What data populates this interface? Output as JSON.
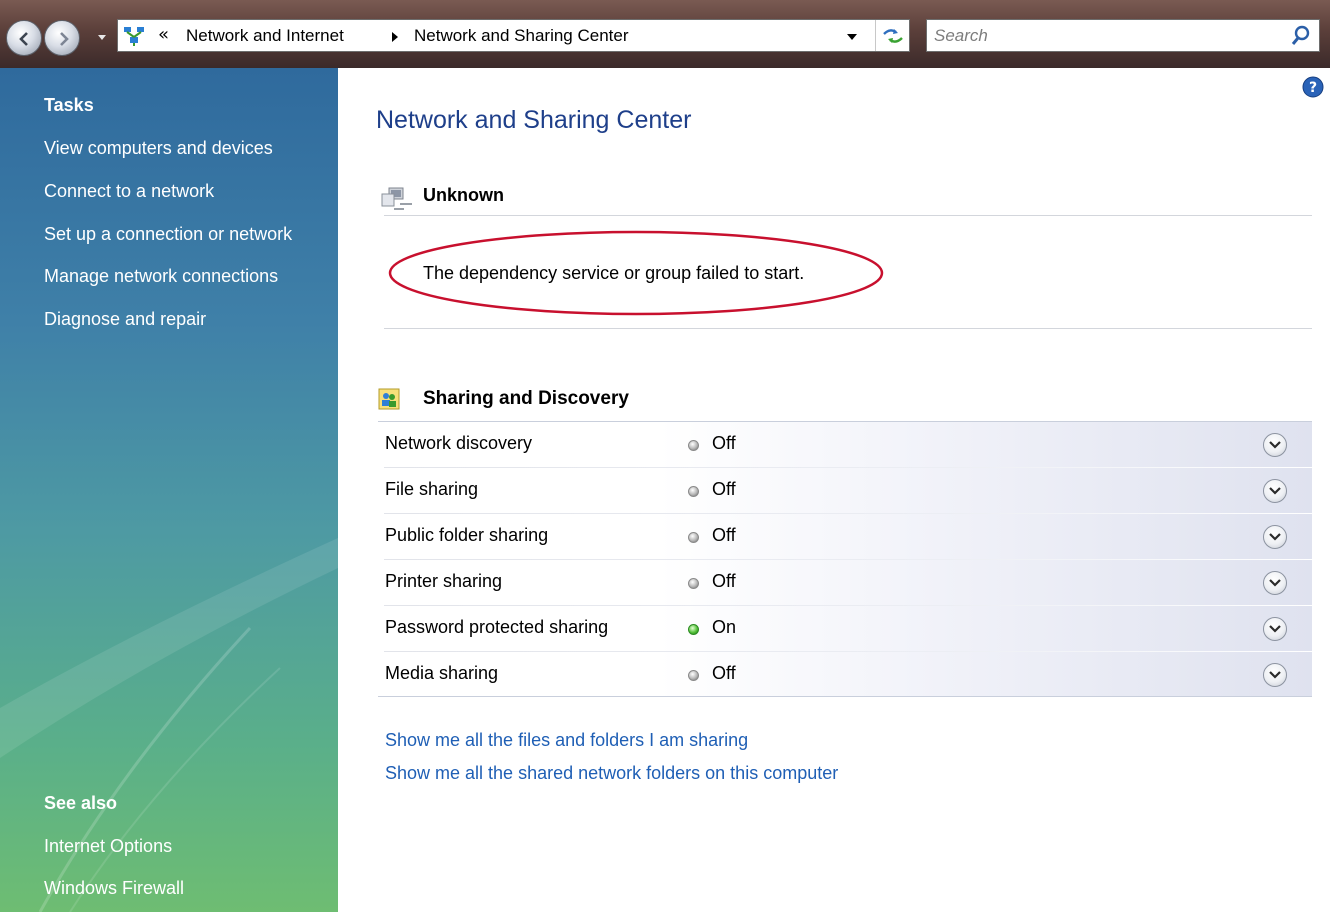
{
  "address_bar": {
    "back_icon": "back-arrow-icon",
    "forward_icon": "forward-arrow-icon",
    "location_icon": "network-icon",
    "overflow_chevron": "«",
    "breadcrumbs": [
      "Network and Internet",
      "Network and Sharing Center"
    ],
    "refresh_icon": "refresh-icon"
  },
  "search": {
    "placeholder": "Search",
    "icon": "search-icon"
  },
  "sidebar": {
    "tasks_heading": "Tasks",
    "tasks": [
      "View computers and devices",
      "Connect to a network",
      "Set up a connection or network",
      "Manage network connections",
      "Diagnose and repair"
    ],
    "see_also_heading": "See also",
    "see_also": [
      "Internet Options",
      "Windows Firewall"
    ]
  },
  "main": {
    "title": "Network and Sharing Center",
    "help_icon": "help-icon",
    "network": {
      "name": "Unknown",
      "error": "The dependency service or group failed to start."
    },
    "sharing": {
      "title": "Sharing and Discovery",
      "rows": [
        {
          "label": "Network discovery",
          "status": "Off",
          "on": false
        },
        {
          "label": "File sharing",
          "status": "Off",
          "on": false
        },
        {
          "label": "Public folder sharing",
          "status": "Off",
          "on": false
        },
        {
          "label": "Printer sharing",
          "status": "Off",
          "on": false
        },
        {
          "label": "Password protected sharing",
          "status": "On",
          "on": true
        },
        {
          "label": "Media sharing",
          "status": "Off",
          "on": false
        }
      ]
    },
    "links": [
      "Show me all the files and folders I am sharing",
      "Show me all the shared network folders on this computer"
    ]
  },
  "colors": {
    "link": "#1f5fb5",
    "title": "#1e3f8a",
    "annotation": "#c8102e",
    "status_on": "#3cb02a",
    "status_off": "#9a9a9a"
  }
}
